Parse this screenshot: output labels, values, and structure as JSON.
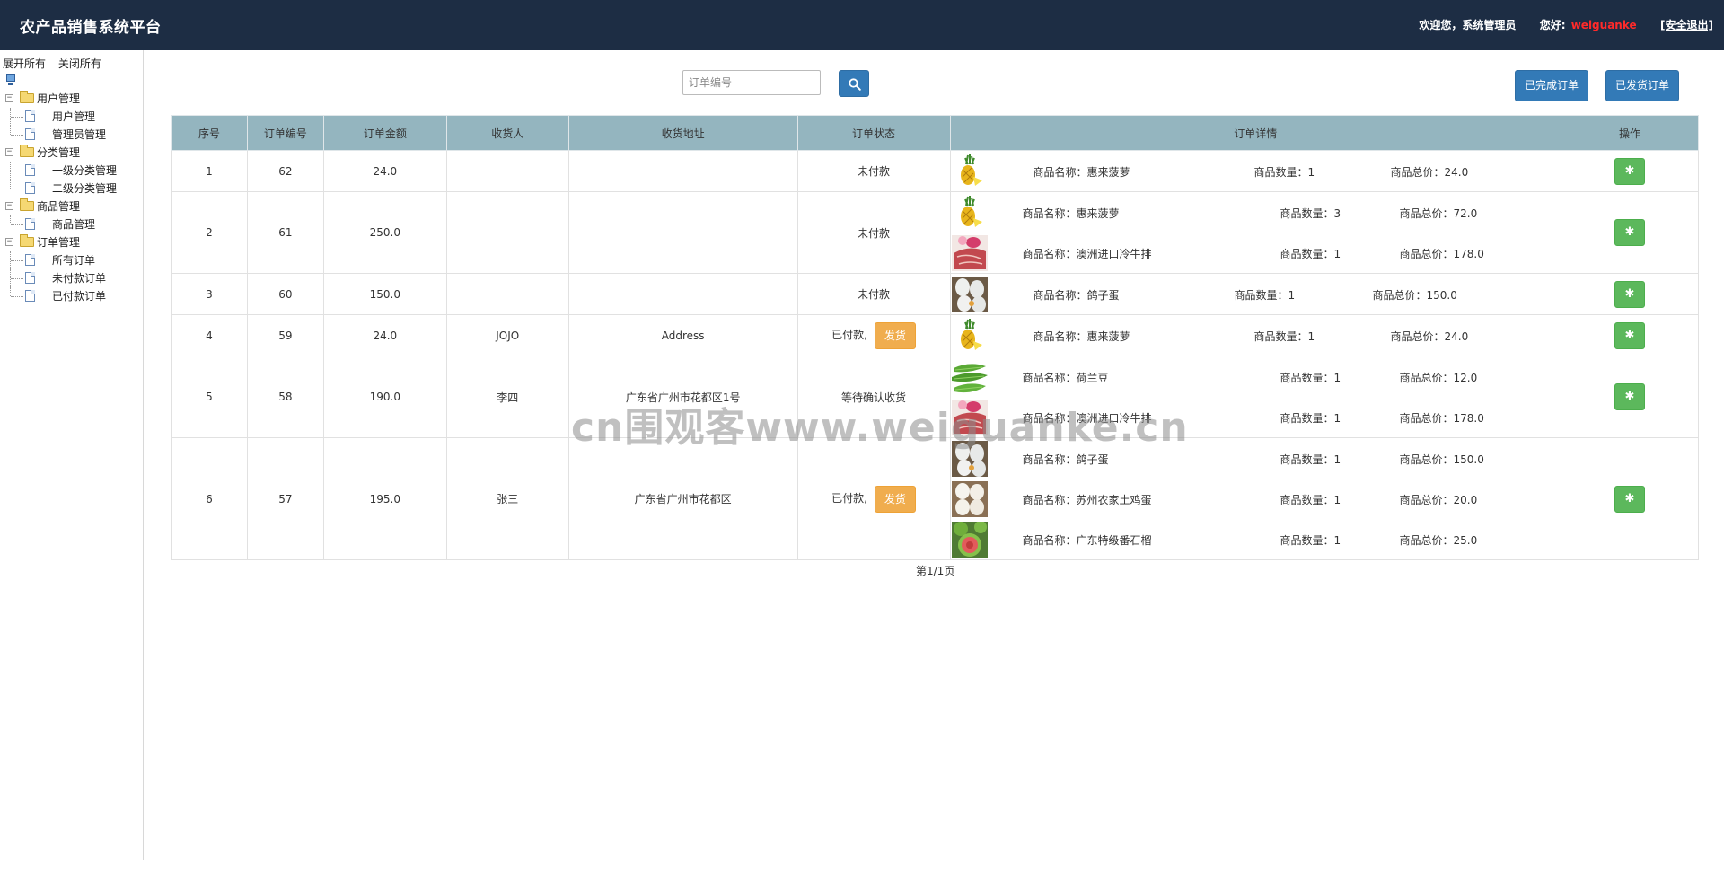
{
  "header": {
    "title": "农产品销售系统平台",
    "welcome": "欢迎您，系统管理员",
    "hello": "您好:",
    "username": "weiguanke",
    "logout": "[安全退出]"
  },
  "sidebar": {
    "expand_all": "展开所有",
    "collapse_all": "关闭所有",
    "groups": [
      {
        "label": "用户管理",
        "items": [
          "用户管理",
          "管理员管理"
        ]
      },
      {
        "label": "分类管理",
        "items": [
          "一级分类管理",
          "二级分类管理"
        ]
      },
      {
        "label": "商品管理",
        "items": [
          "商品管理"
        ]
      },
      {
        "label": "订单管理",
        "items": [
          "所有订单",
          "未付款订单",
          "已付款订单"
        ]
      }
    ]
  },
  "toolbar": {
    "search_placeholder": "订单编号",
    "search_icon": "search-icon",
    "completed_orders": "已完成订单",
    "shipped_orders": "已发货订单"
  },
  "table": {
    "columns": [
      "序号",
      "订单编号",
      "订单金额",
      "收货人",
      "收货地址",
      "订单状态",
      "订单详情",
      "操作"
    ],
    "labels": {
      "name": "商品名称：",
      "qty": "商品数量：",
      "total": "商品总价："
    },
    "ship_label": "发货",
    "action_icon": "gear-icon",
    "action_glyph": "✱",
    "rows": [
      {
        "no": "1",
        "id": "62",
        "amount": "24.0",
        "receiver": "",
        "address": "",
        "status": "未付款",
        "ship": false,
        "items": [
          {
            "img": "pineapple",
            "name": "惠来菠萝",
            "qty": "1",
            "total": "24.0"
          }
        ]
      },
      {
        "no": "2",
        "id": "61",
        "amount": "250.0",
        "receiver": "",
        "address": "",
        "status": "未付款",
        "ship": false,
        "items": [
          {
            "img": "pineapple",
            "name": "惠来菠萝",
            "qty": "3",
            "total": "72.0"
          },
          {
            "img": "beef",
            "name": "澳洲进口冷牛排",
            "qty": "1",
            "total": "178.0"
          }
        ]
      },
      {
        "no": "3",
        "id": "60",
        "amount": "150.0",
        "receiver": "",
        "address": "",
        "status": "未付款",
        "ship": false,
        "items": [
          {
            "img": "eggs",
            "name": "鸽子蛋",
            "qty": "1",
            "total": "150.0"
          }
        ]
      },
      {
        "no": "4",
        "id": "59",
        "amount": "24.0",
        "receiver": "JOJO",
        "address": "Address",
        "status": "已付款,",
        "ship": true,
        "items": [
          {
            "img": "pineapple",
            "name": "惠来菠萝",
            "qty": "1",
            "total": "24.0"
          }
        ]
      },
      {
        "no": "5",
        "id": "58",
        "amount": "190.0",
        "receiver": "李四",
        "address": "广东省广州市花都区1号",
        "status": "等待确认收货",
        "ship": false,
        "items": [
          {
            "img": "peas",
            "name": "荷兰豆",
            "qty": "1",
            "total": "12.0"
          },
          {
            "img": "beef",
            "name": "澳洲进口冷牛排",
            "qty": "1",
            "total": "178.0"
          }
        ]
      },
      {
        "no": "6",
        "id": "57",
        "amount": "195.0",
        "receiver": "张三",
        "address": "广东省广州市花都区",
        "status": "已付款,",
        "ship": true,
        "items": [
          {
            "img": "eggs",
            "name": "鸽子蛋",
            "qty": "1",
            "total": "150.0"
          },
          {
            "img": "white-eggs",
            "name": "苏州农家土鸡蛋",
            "qty": "1",
            "total": "20.0"
          },
          {
            "img": "guava",
            "name": "广东特级番石榴",
            "qty": "1",
            "total": "25.0"
          }
        ]
      }
    ]
  },
  "pager": "第1/1页",
  "watermark": "cn围观客www.weiguanke.cn"
}
